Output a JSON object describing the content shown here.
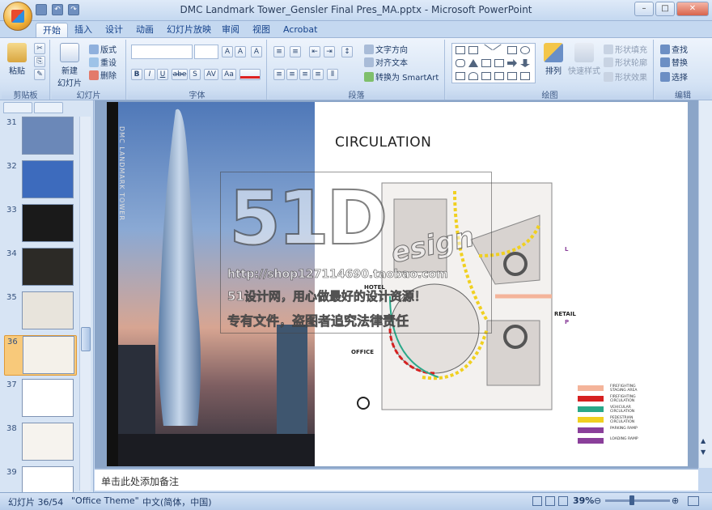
{
  "window": {
    "title": "DMC Landmark Tower_Gensler Final Pres_MA.pptx - Microsoft PowerPoint",
    "buttons": [
      "–",
      "□",
      "✕"
    ]
  },
  "ribbon_tabs": [
    "开始",
    "插入",
    "设计",
    "动画",
    "幻灯片放映",
    "审阅",
    "视图",
    "Acrobat"
  ],
  "ribbon": {
    "clipboard": {
      "label": "剪贴板",
      "paste": "粘贴"
    },
    "slides": {
      "label": "幻灯片",
      "new_slide": "新建",
      "new_slide2": "幻灯片",
      "layout": "版式",
      "reset": "重设",
      "delete": "删除"
    },
    "font": {
      "label": "字体",
      "bold": "B",
      "italic": "I",
      "underline": "U",
      "strike": "abe",
      "shadow": "S",
      "spacing": "AV",
      "case": "Aa",
      "grow": "A",
      "shrink": "A",
      "clear": "A"
    },
    "paragraph": {
      "label": "段落",
      "text_direction": "文字方向",
      "align_text": "对齐文本",
      "smartart": "转换为 SmartArt"
    },
    "drawing": {
      "label": "绘图",
      "arrange": "排列",
      "quick_styles": "快速样式",
      "fill": "形状填充",
      "outline": "形状轮廓",
      "effects": "形状效果"
    },
    "editing": {
      "label": "编辑",
      "find": "查找",
      "replace": "替换",
      "select": "选择"
    }
  },
  "thumbnails": {
    "items": [
      {
        "num": "31",
        "color": "#6b88b8"
      },
      {
        "num": "32",
        "color": "#3d6bbd"
      },
      {
        "num": "33",
        "color": "#1a1a1a"
      },
      {
        "num": "34",
        "color": "#2c2a26"
      },
      {
        "num": "35",
        "color": "#e8e4dc"
      },
      {
        "num": "36",
        "color": "#f4f1ea",
        "selected": true
      },
      {
        "num": "37",
        "color": "#ffffff"
      },
      {
        "num": "38",
        "color": "#f6f3ee"
      },
      {
        "num": "39",
        "color": "#ffffff"
      }
    ]
  },
  "slide": {
    "title": "CIRCULATION",
    "side_text": "DMC LANDMARK TOWER",
    "plan_labels": {
      "hotel": "HOTEL",
      "office": "OFFICE",
      "retail": "RETAIL",
      "p": "P",
      "l": "L"
    },
    "legend": [
      {
        "label": "FIREFIGHTING STAGING AREA",
        "color": "#f4b49a"
      },
      {
        "label": "FIREFIGHTING CIRCULATION",
        "color": "#d62020"
      },
      {
        "label": "VEHICULAR CIRCULATION",
        "color": "#29a889"
      },
      {
        "label": "PEDESTRIAN CIRCULATION",
        "color": "#f0d020"
      },
      {
        "label": "PARKING RAMP",
        "color": "#8a3f9a"
      },
      {
        "label": "LOADING RAMP",
        "color": "#8a3f9a"
      }
    ]
  },
  "watermark": {
    "big": "51D",
    "esign": "esign",
    "url": "http://shop127114690.taobao.com",
    "line1": "51设计网，用心做最好的设计资源！",
    "line2": "专有文件，盗图者追究法律责任"
  },
  "notes_placeholder": "单击此处添加备注",
  "status": {
    "slide_count": "幻灯片 36/54",
    "theme": "\"Office Theme\"",
    "language": "中文(简体，中国)",
    "zoom": "39%"
  }
}
